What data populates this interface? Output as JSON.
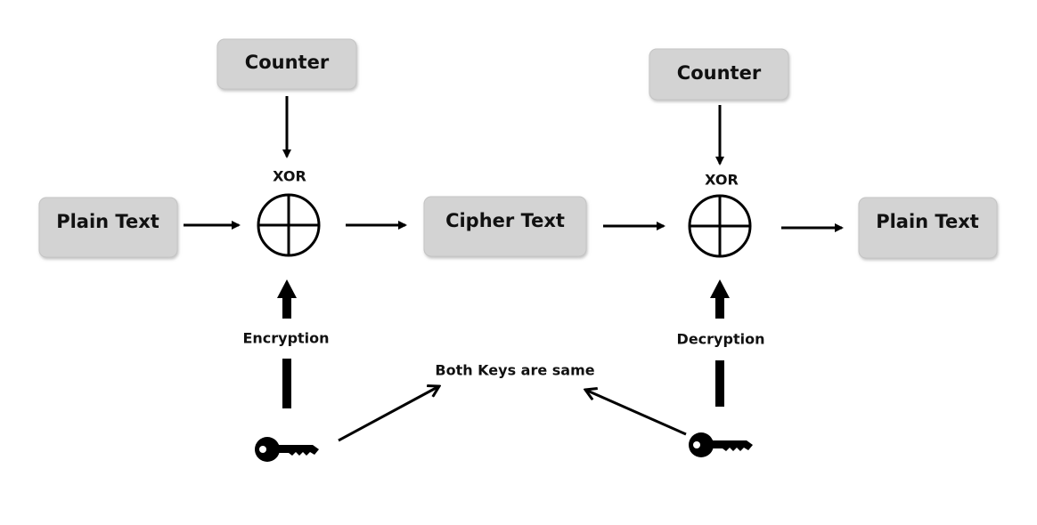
{
  "diagram": {
    "counter_left": "Counter",
    "counter_right": "Counter",
    "xor_left": "XOR",
    "xor_right": "XOR",
    "plain_text_left": "Plain Text",
    "cipher_text": "Cipher Text",
    "plain_text_right": "Plain Text",
    "encryption_label": "Encryption",
    "decryption_label": "Decryption",
    "keys_note": "Both Keys are same",
    "colors": {
      "box_fill": "#d3d3d3",
      "stroke": "#000000"
    },
    "icons": [
      "key-icon",
      "xor-icon",
      "arrow-icon"
    ]
  }
}
